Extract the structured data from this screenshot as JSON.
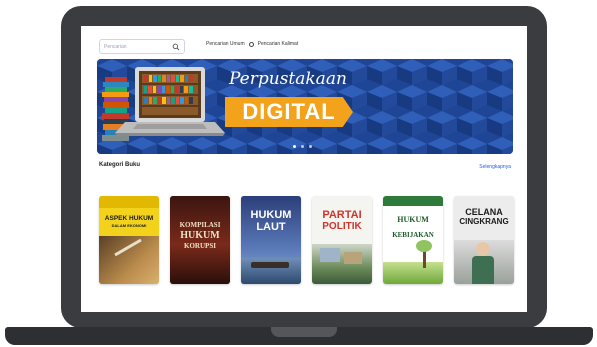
{
  "search": {
    "placeholder": "Pencarian"
  },
  "search_mode": {
    "options": [
      {
        "label": "Pencarian Umum",
        "checked": true
      },
      {
        "label": "Pencarian Kalimat",
        "checked": false
      }
    ]
  },
  "banner": {
    "script_title": "Perpustakaan",
    "main_title": "DIGITAL"
  },
  "carousel": {
    "slides": 3,
    "active": 0
  },
  "section": {
    "title": "Kategori Buku",
    "see_all": "Selengkapnya"
  },
  "books": [
    {
      "title_line1": "ASPEK HUKUM",
      "title_line2": "DALAM EKONOMI"
    },
    {
      "title_line1": "KOMPILASI",
      "title_line2": "HUKUM",
      "title_line3": "KORUPSI"
    },
    {
      "title_line1": "HUKUM",
      "title_line2": "LAUT"
    },
    {
      "title_line1": "PARTAI",
      "title_line2": "POLITIK"
    },
    {
      "title_line1": "HUKUM",
      "title_line2": "KEBIJAKAN"
    },
    {
      "title_line1": "CELANA",
      "title_line2": "CINGKRANG"
    }
  ],
  "colors": {
    "accent": "#f2a31b",
    "link": "#2563d6",
    "banner_bg": "#1d3f8f",
    "frame": "#3b3c3f"
  }
}
